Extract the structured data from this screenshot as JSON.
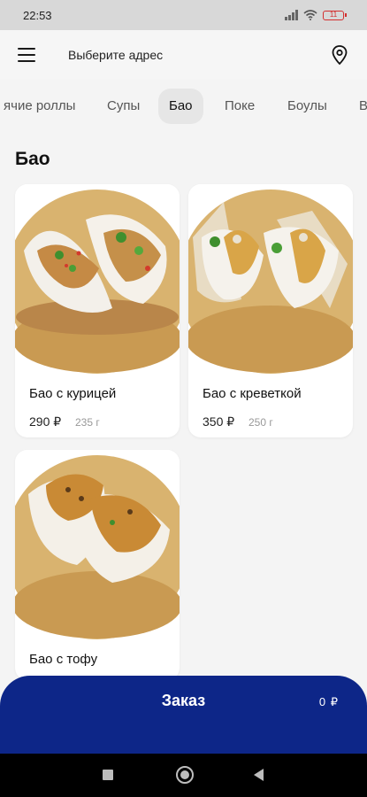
{
  "status": {
    "time": "22:53",
    "battery": "11"
  },
  "header": {
    "address_label": "Выберите адрес"
  },
  "tabs": [
    {
      "label": "ячие роллы"
    },
    {
      "label": "Супы"
    },
    {
      "label": "Бао"
    },
    {
      "label": "Поке"
    },
    {
      "label": "Боулы"
    },
    {
      "label": "В"
    }
  ],
  "section": {
    "title": "Бао"
  },
  "products": [
    {
      "name": "Бао с курицей",
      "price": "290 ₽",
      "weight": "235 г"
    },
    {
      "name": "Бао с креветкой",
      "price": "350 ₽",
      "weight": "250 г"
    },
    {
      "name": "Бао с тофу"
    }
  ],
  "order": {
    "label": "Заказ",
    "price": "0 ₽"
  },
  "colors": {
    "accent": "#0d2688",
    "background": "#f4f4f4",
    "card": "#ffffff"
  },
  "icons": [
    "menu-icon",
    "location-pin-icon",
    "wifi-icon",
    "signal-icon",
    "battery-icon",
    "home-icon",
    "back-icon",
    "recents-icon"
  ]
}
